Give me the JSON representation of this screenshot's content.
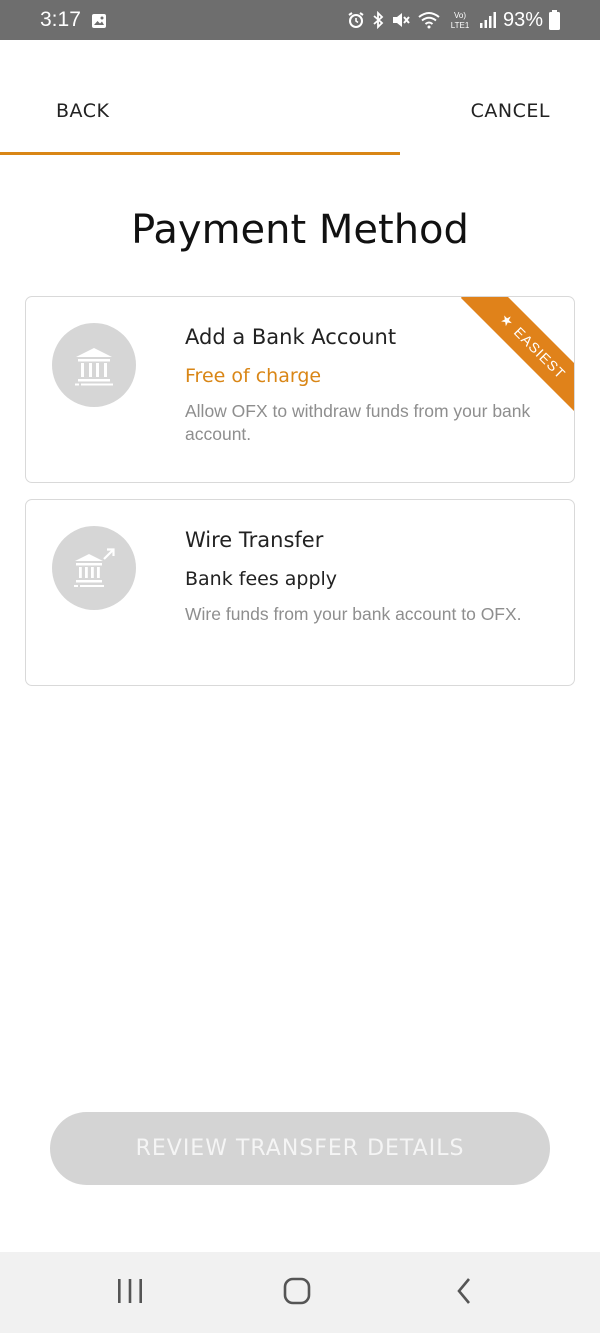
{
  "status_bar": {
    "time": "3:17",
    "battery": "93%",
    "icons": [
      "image-icon",
      "alarm-icon",
      "bluetooth-icon",
      "mute-icon",
      "wifi-icon",
      "volte-icon",
      "signal-icon",
      "battery-icon"
    ]
  },
  "nav": {
    "back_label": "BACK",
    "cancel_label": "CANCEL",
    "progress": 0.667
  },
  "page": {
    "title": "Payment Method"
  },
  "options": [
    {
      "title": "Add a Bank Account",
      "subtitle": "Free of charge",
      "description": "Allow OFX to withdraw funds from your bank account.",
      "icon": "bank-icon",
      "badge": "EASIEST"
    },
    {
      "title": "Wire Transfer",
      "subtitle": "Bank fees apply",
      "description": "Wire funds from your bank account to OFX.",
      "icon": "bank-transfer-icon"
    }
  ],
  "footer": {
    "review_label": "REVIEW TRANSFER DETAILS"
  },
  "colors": {
    "accent": "#d98616",
    "ribbon": "#e0821a",
    "disabled_button": "#d4d4d4",
    "status_bar": "#6e6e6e"
  }
}
